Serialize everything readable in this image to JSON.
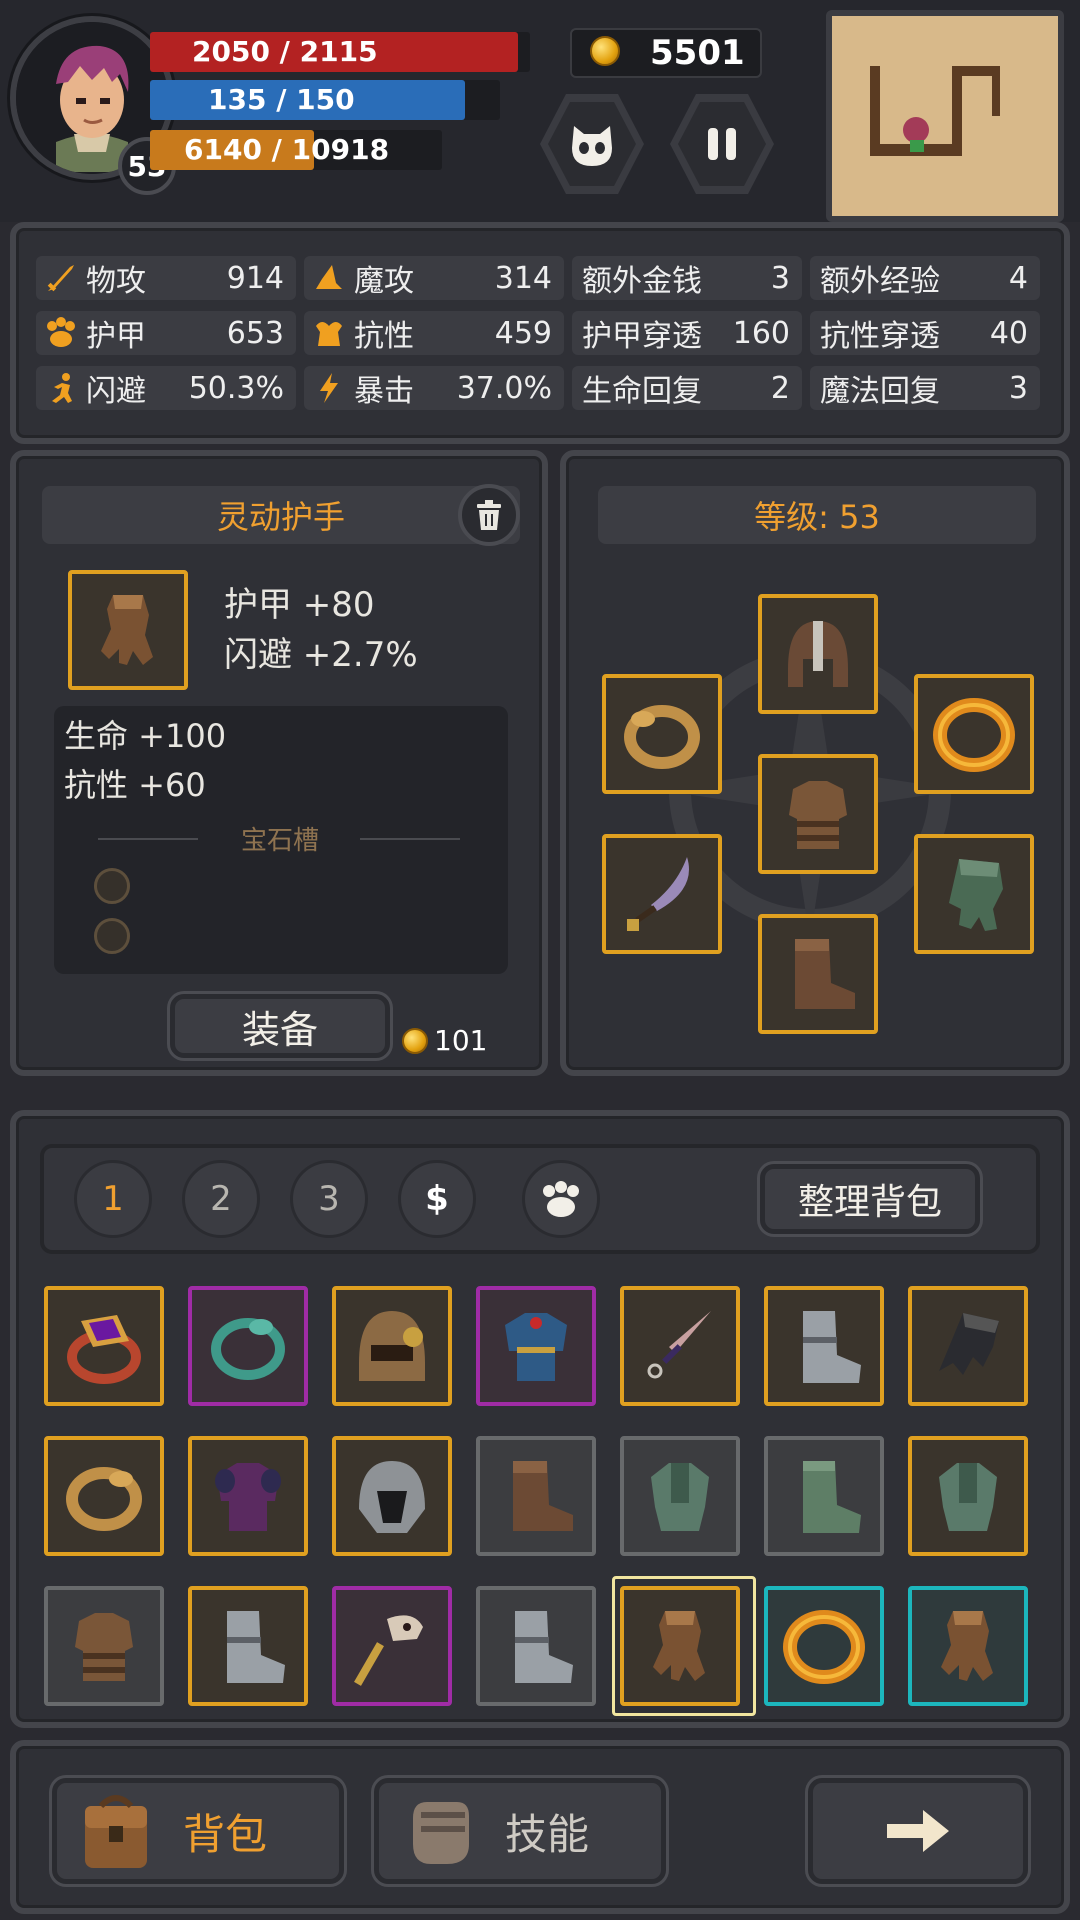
{
  "player": {
    "level": "53",
    "hp": "2050 / 2115",
    "hp_fill": 0.969,
    "mp": "135 / 150",
    "mp_fill": 0.9,
    "exp": "6140 / 10918",
    "exp_fill": 0.562
  },
  "gold": "5501",
  "stats": [
    {
      "icon": "sword-icon",
      "label": "物攻",
      "value": "914"
    },
    {
      "icon": "magic-hat-icon",
      "label": "魔攻",
      "value": "314"
    },
    {
      "icon": "",
      "label": "额外金钱",
      "value": "3"
    },
    {
      "icon": "",
      "label": "额外经验",
      "value": "4"
    },
    {
      "icon": "paw-armor-icon",
      "label": "护甲",
      "value": "653"
    },
    {
      "icon": "muscle-icon",
      "label": "抗性",
      "value": "459"
    },
    {
      "icon": "",
      "label": "护甲穿透",
      "value": "160"
    },
    {
      "icon": "",
      "label": "抗性穿透",
      "value": "40"
    },
    {
      "icon": "running-icon",
      "label": "闪避",
      "value": "50.3%"
    },
    {
      "icon": "lightning-icon",
      "label": "暴击",
      "value": "37.0%"
    },
    {
      "icon": "",
      "label": "生命回复",
      "value": "2"
    },
    {
      "icon": "",
      "label": "魔法回复",
      "value": "3"
    }
  ],
  "item_detail": {
    "name": "灵动护手",
    "main_stats": [
      "护甲 +80",
      "闪避 +2.7%"
    ],
    "extra_stats": [
      "生命 +100",
      "抗性 +60"
    ],
    "gem_slot_label": "宝石槽",
    "equip_label": "装备",
    "price": "101"
  },
  "equipment": {
    "level_label": "等级: 53"
  },
  "inventory": {
    "tabs": [
      "1",
      "2",
      "3"
    ],
    "sort_label": "整理背包"
  },
  "bottom_nav": {
    "bag_label": "背包",
    "skills_label": "技能"
  },
  "colors": {
    "hp": "#b32222",
    "mp": "#2a6db8",
    "exp": "#c87a1c",
    "gold_border": "#e0a020",
    "purple_border": "#a02ca6",
    "cyan_border": "#1cb6bd",
    "accent": "#f0a030"
  }
}
